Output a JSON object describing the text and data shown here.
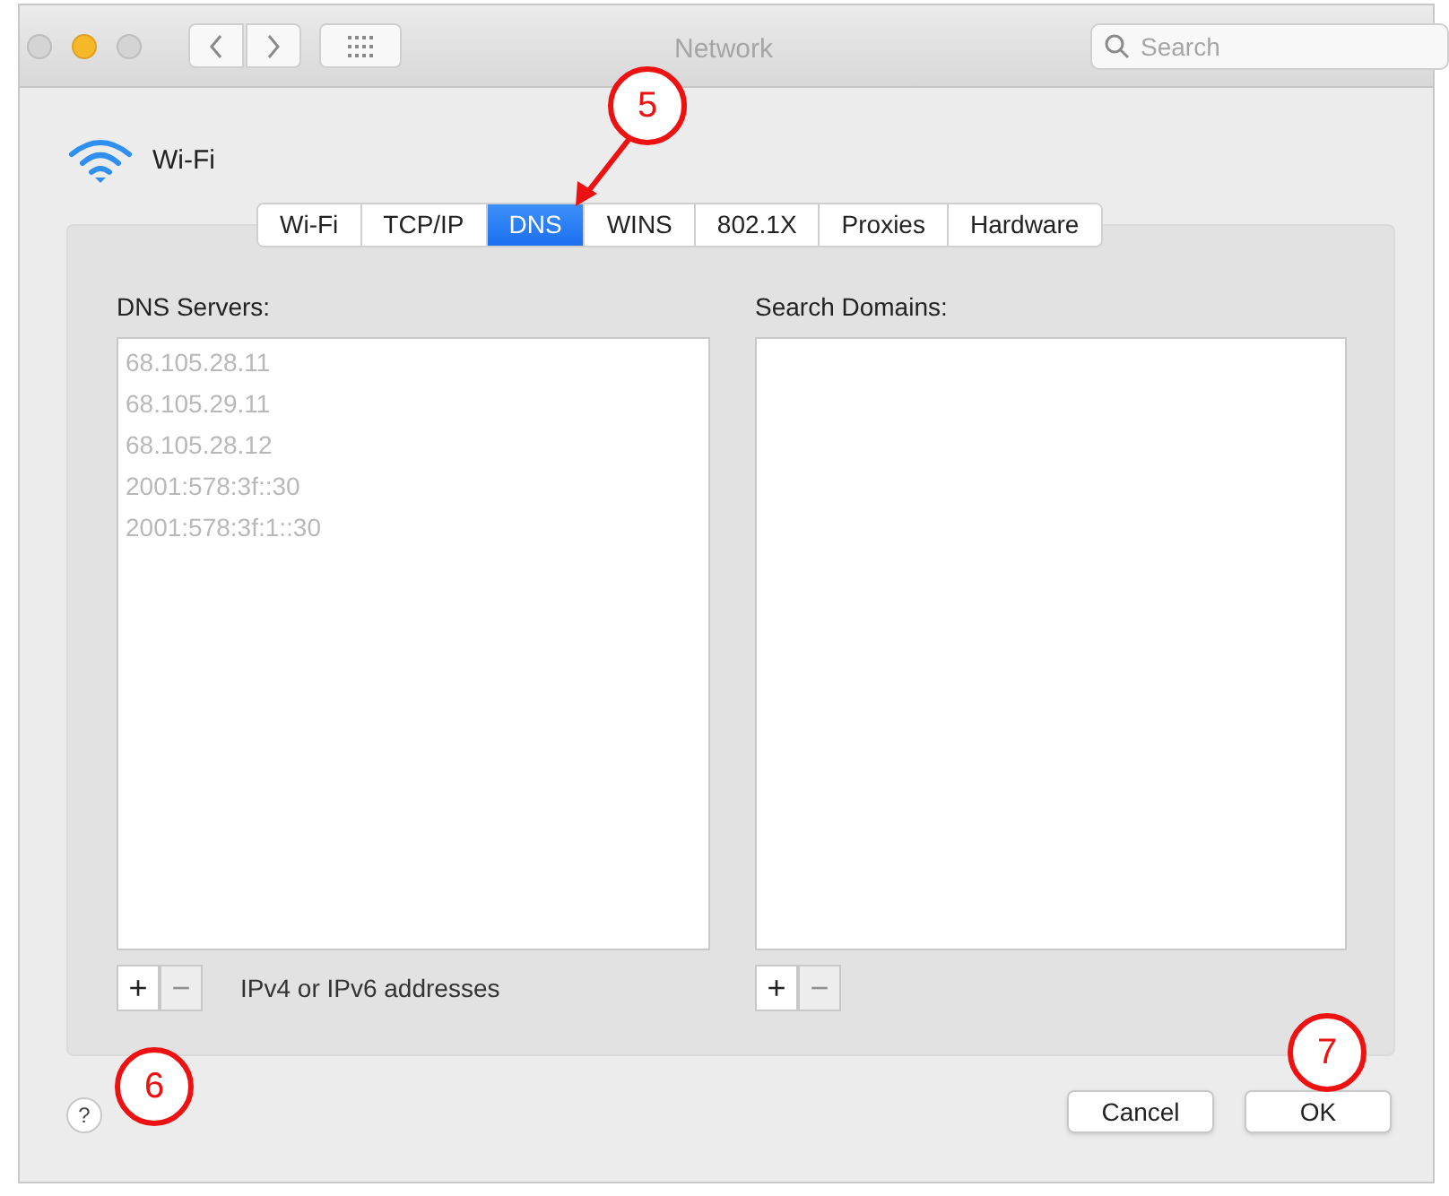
{
  "window": {
    "title": "Network",
    "search": {
      "placeholder": "Search"
    }
  },
  "interface": {
    "name": "Wi-Fi"
  },
  "tabs": [
    {
      "label": "Wi-Fi",
      "selected": false
    },
    {
      "label": "TCP/IP",
      "selected": false
    },
    {
      "label": "DNS",
      "selected": true
    },
    {
      "label": "WINS",
      "selected": false
    },
    {
      "label": "802.1X",
      "selected": false
    },
    {
      "label": "Proxies",
      "selected": false
    },
    {
      "label": "Hardware",
      "selected": false
    }
  ],
  "dns_servers": {
    "label": "DNS Servers:",
    "items": [
      "68.105.28.11",
      "68.105.29.11",
      "68.105.28.12",
      "2001:578:3f::30",
      "2001:578:3f:1::30"
    ],
    "buttons": [
      {
        "label": "+",
        "disabled": false
      },
      {
        "label": "−",
        "disabled": true
      }
    ],
    "hint": "IPv4 or IPv6 addresses"
  },
  "search_domains": {
    "label": "Search Domains:",
    "buttons": [
      {
        "label": "+",
        "disabled": false
      },
      {
        "label": "−",
        "disabled": true
      }
    ]
  },
  "help": "?",
  "buttons": [
    "Cancel",
    "OK"
  ],
  "callouts": [
    "5",
    "6",
    "7"
  ]
}
